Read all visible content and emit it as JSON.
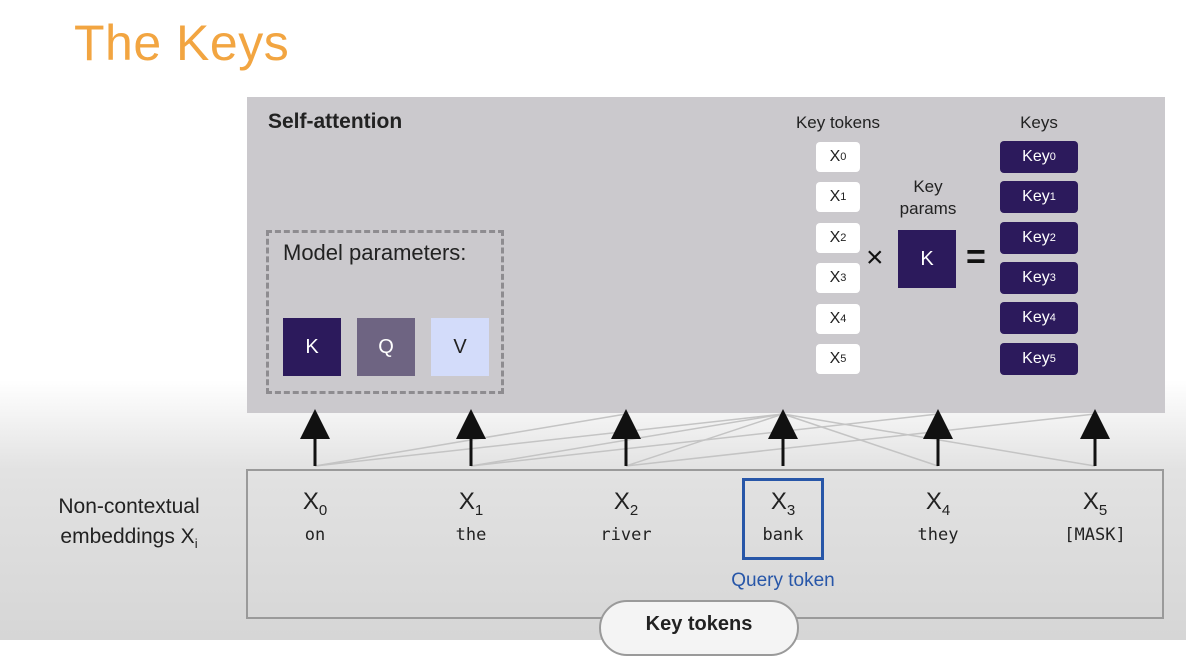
{
  "title": "The Keys",
  "panel": {
    "label": "Self-attention",
    "model_parameters": {
      "label": "Model parameters:",
      "params": [
        {
          "label": "K",
          "color": "#2c1a5c"
        },
        {
          "label": "Q",
          "color": "#6e6482"
        },
        {
          "label": "V",
          "color": "#d3dcfa"
        }
      ]
    },
    "key_tokens_header": "Key tokens",
    "key_tokens": [
      {
        "base": "X",
        "sub": "0"
      },
      {
        "base": "X",
        "sub": "1"
      },
      {
        "base": "X",
        "sub": "2"
      },
      {
        "base": "X",
        "sub": "3"
      },
      {
        "base": "X",
        "sub": "4"
      },
      {
        "base": "X",
        "sub": "5"
      }
    ],
    "multiply_symbol": "×",
    "key_params_label_line1": "Key",
    "key_params_label_line2": "params",
    "key_param_box": "K",
    "equals_symbol": "=",
    "keys_header": "Keys",
    "keys": [
      {
        "base": "Key",
        "sub": "0"
      },
      {
        "base": "Key",
        "sub": "1"
      },
      {
        "base": "Key",
        "sub": "2"
      },
      {
        "base": "Key",
        "sub": "3"
      },
      {
        "base": "Key",
        "sub": "4"
      },
      {
        "base": "Key",
        "sub": "5"
      }
    ]
  },
  "embeddings": {
    "label_line1": "Non-contextual",
    "label_line2": "embeddings X",
    "label_sub": "i",
    "tokens": [
      {
        "base": "X",
        "sub": "0",
        "word": "on"
      },
      {
        "base": "X",
        "sub": "1",
        "word": "the"
      },
      {
        "base": "X",
        "sub": "2",
        "word": "river"
      },
      {
        "base": "X",
        "sub": "3",
        "word": "bank"
      },
      {
        "base": "X",
        "sub": "4",
        "word": "they"
      },
      {
        "base": "X",
        "sub": "5",
        "word": "[MASK]"
      }
    ],
    "query_label": "Query token",
    "key_tokens_pill": "Key tokens"
  },
  "colors": {
    "title": "#f2a541",
    "panel": "#cbc9cd",
    "key_dark": "#2c1a5c",
    "query": "#2756a8"
  }
}
